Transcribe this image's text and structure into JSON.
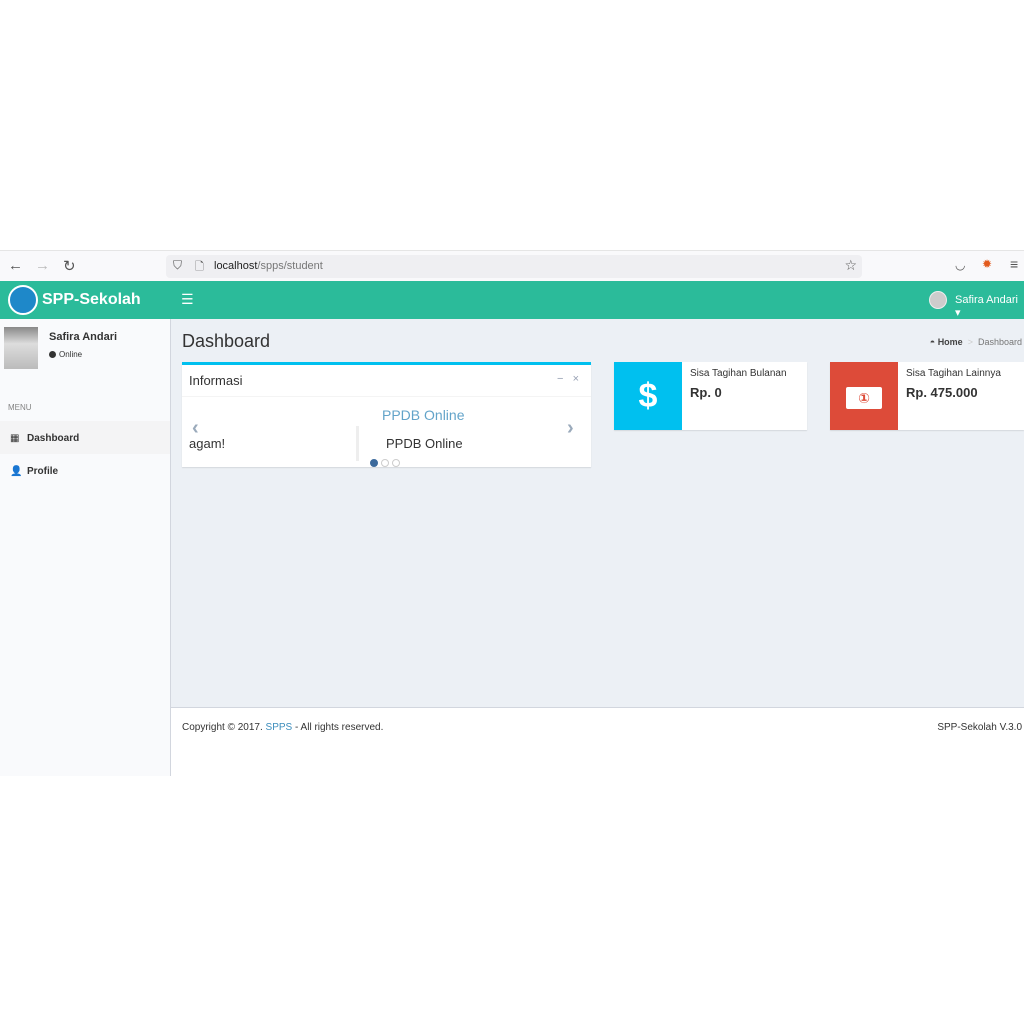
{
  "browser": {
    "url_host": "localhost",
    "url_path": "/spps/student"
  },
  "header": {
    "brand": "SPP-Sekolah",
    "user_name": "Safira Andari"
  },
  "sidebar": {
    "user_name": "Safira Andari",
    "status": "Online",
    "menu_header": "MENU",
    "items": [
      {
        "label": "Dashboard",
        "active": true
      },
      {
        "label": "Profile",
        "active": false
      }
    ]
  },
  "page": {
    "title": "Dashboard",
    "breadcrumb": [
      "Home",
      "Dashboard"
    ]
  },
  "info_box": {
    "title": "Informasi",
    "slide_title": "PPDB Online",
    "prev_slide_text": "agam!",
    "slide_body": "PPDB Online",
    "slide_count": 3,
    "active_slide": 1
  },
  "stats": [
    {
      "label": "Sisa Tagihan Bulanan",
      "value": "Rp. 0",
      "icon": "dollar-icon",
      "color": "#00c0ef"
    },
    {
      "label": "Sisa Tagihan Lainnya",
      "value": "Rp. 475.000",
      "icon": "money-icon",
      "color": "#dd4b39"
    }
  ],
  "footer": {
    "copyright_prefix": "Copyright © 2017.",
    "link": "SPPS",
    "copyright_suffix": " - All rights reserved.",
    "version": "SPP-Sekolah V.3.0"
  }
}
